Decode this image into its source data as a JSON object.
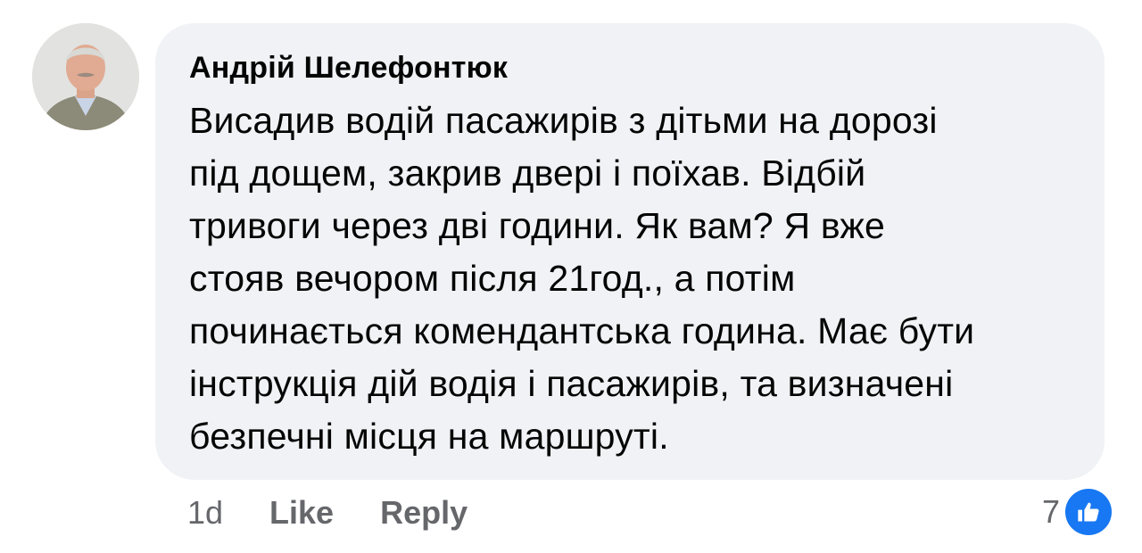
{
  "comment": {
    "author": "Андрій Шелефонтюк",
    "text": "Висадив водій пасажирів з дітьми на дорозі\nпід дощем, закрив двері і поїхав. Відбій\nтривоги через дві години. Як вам? Я вже\nстояв вечором після 21год., а потім\nпочинається комендантська година. Має бути\nінструкція дій водія і пасажирів, та визначені\nбезпечні місця на маршруті.",
    "time": "1d",
    "like_label": "Like",
    "reply_label": "Reply",
    "reaction_count": "7",
    "reaction_icon": "thumbs-up-icon"
  },
  "colors": {
    "bubble_bg": "#f0f2f5",
    "text": "#050505",
    "meta_text": "#65676b",
    "accent": "#1877f2"
  }
}
